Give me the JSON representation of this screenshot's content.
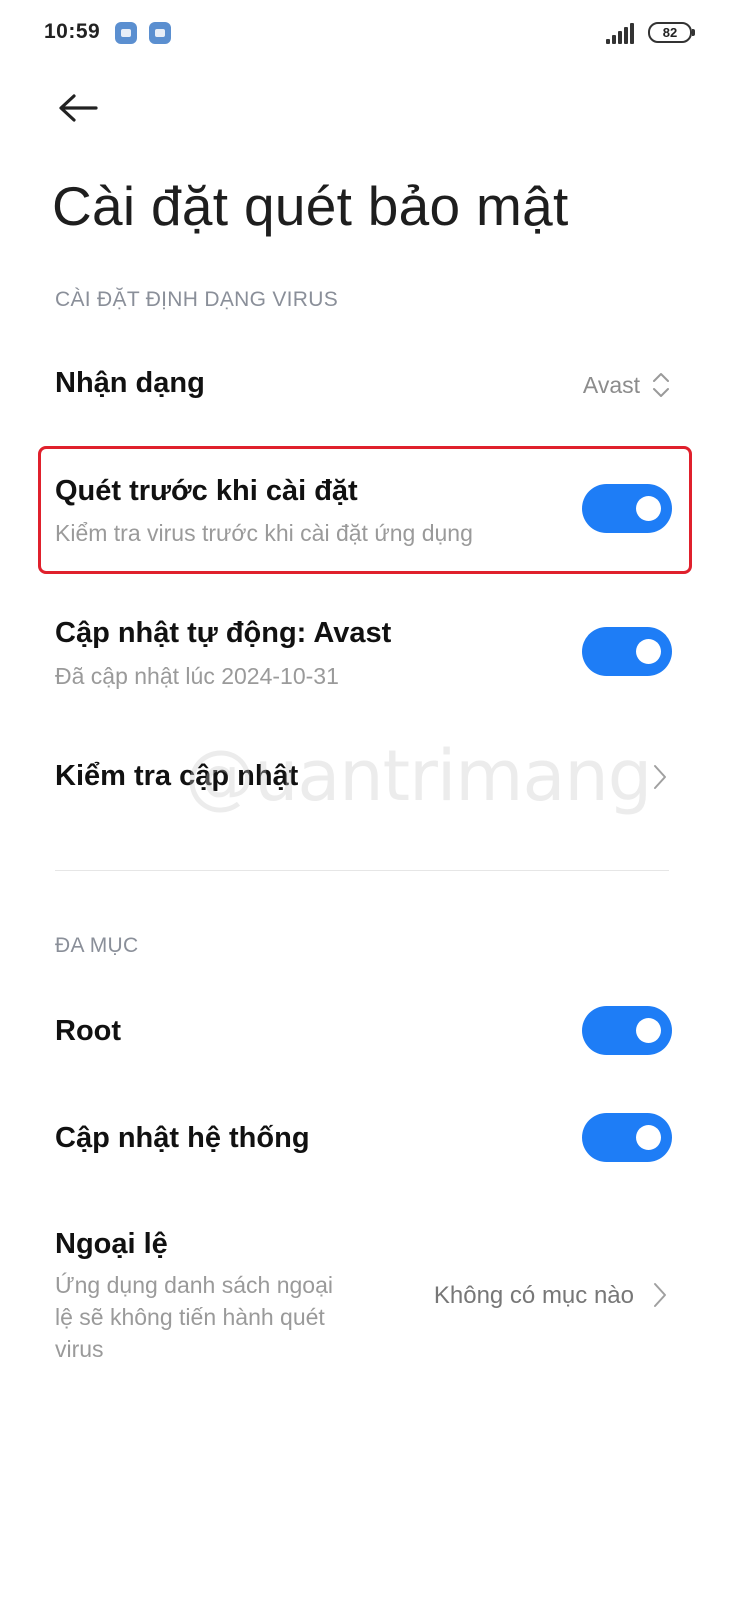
{
  "status_bar": {
    "time": "10:59",
    "battery": "82"
  },
  "header": {
    "title": "Cài đặt quét bảo mật"
  },
  "sections": {
    "virus": {
      "label": "CÀI ĐẶT ĐỊNH DẠNG VIRUS"
    },
    "misc": {
      "label": "ĐA MỤC"
    }
  },
  "items": {
    "recognition": {
      "title": "Nhận dạng",
      "value": "Avast"
    },
    "scan_before_install": {
      "title": "Quét trước khi cài đặt",
      "subtitle": "Kiểm tra virus trước khi cài đặt ứng dụng",
      "enabled": true
    },
    "auto_update": {
      "title": "Cập nhật tự động: Avast",
      "subtitle": "Đã cập nhật lúc 2024-10-31",
      "enabled": true
    },
    "check_update": {
      "title": "Kiểm tra cập nhật"
    },
    "root": {
      "title": "Root",
      "enabled": true
    },
    "system_update": {
      "title": "Cập nhật hệ thống",
      "enabled": true
    },
    "exceptions": {
      "title": "Ngoại lệ",
      "subtitle_line1": "Ứng dụng danh sách ngoại",
      "subtitle_line2": "lệ sẽ không tiến hành quét",
      "subtitle_line3": "virus",
      "value": "Không có mục nào"
    }
  },
  "watermark": {
    "text": "@uantrimang"
  },
  "colors": {
    "accent": "#1e7df6",
    "highlight": "#e0202c"
  }
}
